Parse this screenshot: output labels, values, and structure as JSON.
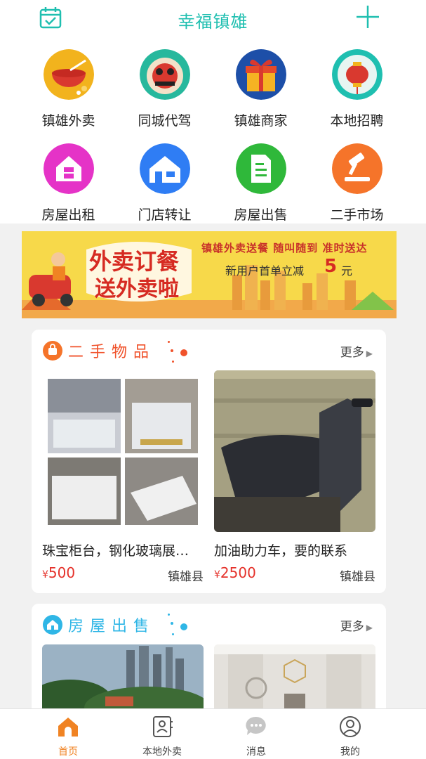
{
  "header": {
    "title": "幸福镇雄",
    "calendar_icon": "calendar-check-icon",
    "add_icon": "plus-icon"
  },
  "grid": [
    {
      "label": "镇雄外卖",
      "icon": "food-bowl-icon",
      "color": "#f2b31d"
    },
    {
      "label": "同城代驾",
      "icon": "driver-icon",
      "color": "#d9392f"
    },
    {
      "label": "镇雄商家",
      "icon": "gift-icon",
      "color": "#1d4fa8"
    },
    {
      "label": "本地招聘",
      "icon": "lantern-icon",
      "color": "#1fbfb0"
    },
    {
      "label": "房屋出租",
      "icon": "house-rent-icon",
      "color": "#e533c7"
    },
    {
      "label": "门店转让",
      "icon": "store-icon",
      "color": "#2f7df4"
    },
    {
      "label": "房屋出售",
      "icon": "house-doc-icon",
      "color": "#2fb83a"
    },
    {
      "label": "二手市场",
      "icon": "auction-hammer-icon",
      "color": "#f5742a"
    }
  ],
  "banner": {
    "big_text": "外卖订餐送外卖啦",
    "title": "镇雄外卖送餐 随叫随到 准时送达",
    "subtitle": "新用户首单立减",
    "discount": "5",
    "unit": "元"
  },
  "secondhand": {
    "title": "二手物品",
    "more": "更多",
    "items": [
      {
        "title": "珠宝柜台，钢化玻璃展…",
        "currency": "¥",
        "price": "500",
        "location": "镇雄县"
      },
      {
        "title": "加油助力车，要的联系",
        "currency": "¥",
        "price": "2500",
        "location": "镇雄县"
      }
    ]
  },
  "housesale": {
    "title": "房屋出售",
    "more": "更多"
  },
  "tabs": [
    {
      "label": "首页",
      "icon": "home-icon",
      "active": true
    },
    {
      "label": "本地外卖",
      "icon": "contacts-book-icon",
      "active": false
    },
    {
      "label": "消息",
      "icon": "chat-bubble-icon",
      "active": false
    },
    {
      "label": "我的",
      "icon": "user-icon",
      "active": false
    }
  ],
  "colors": {
    "accent": "#1fbfb0",
    "price": "#e5322b",
    "tab_active": "#f08323"
  }
}
